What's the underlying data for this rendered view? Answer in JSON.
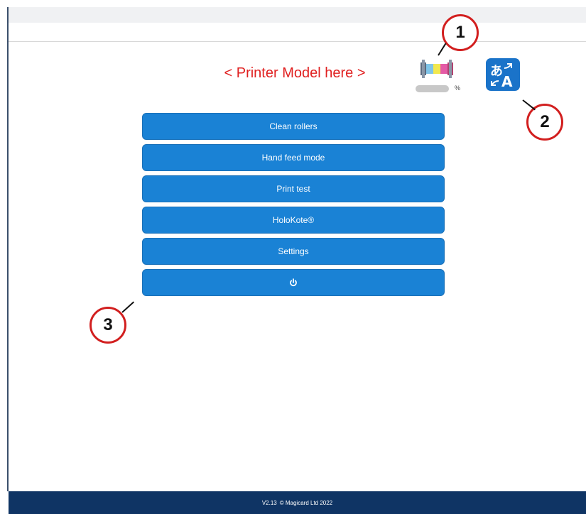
{
  "header": {
    "printer_model": "< Printer Model here >",
    "ribbon_unit": "%",
    "ribbon_level_percent": null
  },
  "language": {
    "icon": "translate-icon"
  },
  "menu": {
    "items": [
      {
        "label": "Clean rollers"
      },
      {
        "label": "Hand feed mode"
      },
      {
        "label": "Print test"
      },
      {
        "label": "HoloKote®"
      },
      {
        "label": "Settings"
      },
      {
        "label": "",
        "icon": "power-icon"
      }
    ]
  },
  "callouts": [
    "1",
    "2",
    "3"
  ],
  "footer": {
    "version": "V2.13",
    "copyright": "© Magicard Ltd 2022"
  },
  "colors": {
    "button": "#1a82d5",
    "footer": "#0f3464",
    "title": "#e02020",
    "callout_ring": "#d21f1f",
    "language_button": "#1a73c9"
  }
}
